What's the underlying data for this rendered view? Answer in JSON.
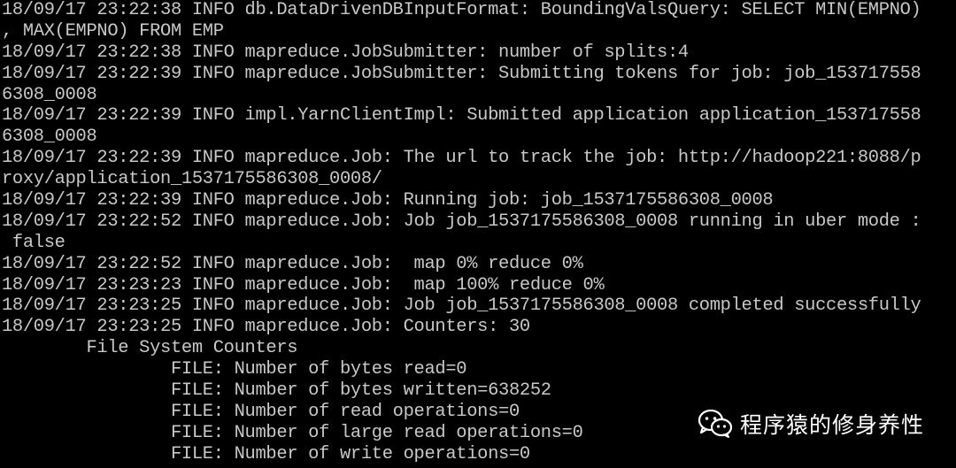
{
  "terminal": {
    "lines": [
      "18/09/17 23:22:38 INFO db.DataDrivenDBInputFormat: BoundingValsQuery: SELECT MIN(EMPNO)",
      ", MAX(EMPNO) FROM EMP",
      "18/09/17 23:22:38 INFO mapreduce.JobSubmitter: number of splits:4",
      "18/09/17 23:22:39 INFO mapreduce.JobSubmitter: Submitting tokens for job: job_153717558",
      "6308_0008",
      "18/09/17 23:22:39 INFO impl.YarnClientImpl: Submitted application application_153717558",
      "6308_0008",
      "18/09/17 23:22:39 INFO mapreduce.Job: The url to track the job: http://hadoop221:8088/p",
      "roxy/application_1537175586308_0008/",
      "18/09/17 23:22:39 INFO mapreduce.Job: Running job: job_1537175586308_0008",
      "18/09/17 23:22:52 INFO mapreduce.Job: Job job_1537175586308_0008 running in uber mode :",
      " false",
      "18/09/17 23:22:52 INFO mapreduce.Job:  map 0% reduce 0%",
      "18/09/17 23:23:23 INFO mapreduce.Job:  map 100% reduce 0%",
      "18/09/17 23:23:25 INFO mapreduce.Job: Job job_1537175586308_0008 completed successfully",
      "18/09/17 23:23:25 INFO mapreduce.Job: Counters: 30",
      "        File System Counters",
      "                FILE: Number of bytes read=0",
      "                FILE: Number of bytes written=638252",
      "                FILE: Number of read operations=0",
      "                FILE: Number of large read operations=0",
      "                FILE: Number of write operations=0"
    ]
  },
  "watermark": {
    "text": "程序猿的修身养性",
    "icon": "wechat-icon"
  },
  "colors": {
    "background": "#000000",
    "text": "#c8c8c8",
    "watermark": "#ffffff"
  }
}
